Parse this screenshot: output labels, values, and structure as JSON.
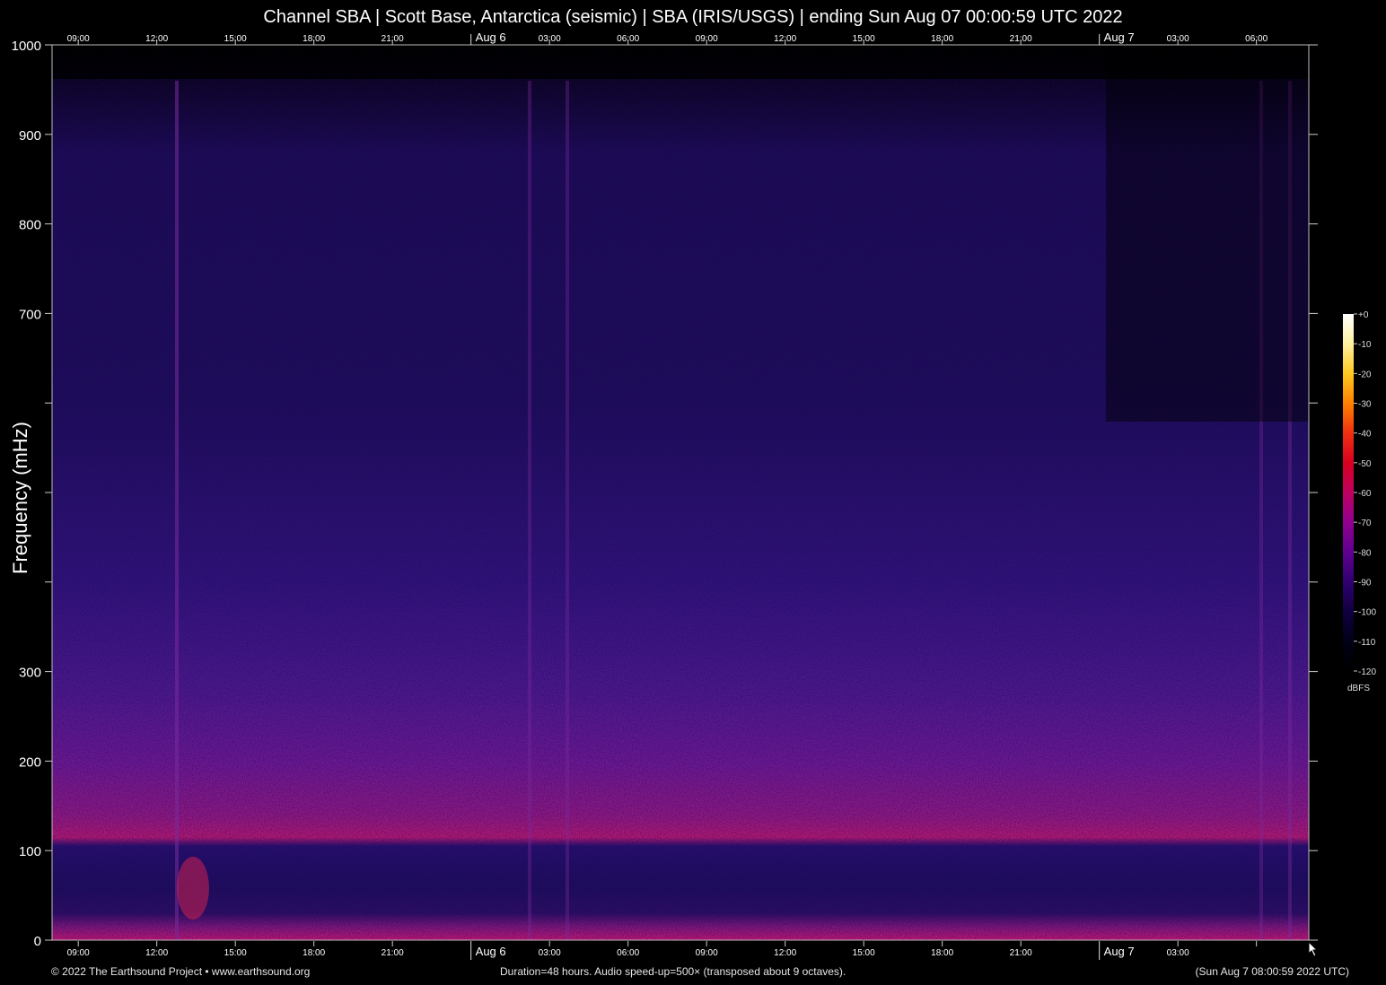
{
  "title": "Channel SBA | Scott Base, Antarctica (seismic) | SBA (IRIS/USGS) | ending Sun Aug 07 00:00:59 UTC 2022",
  "footer": {
    "left": "© 2022 The Earthsound Project • www.earthsound.org",
    "middle": "Duration=48 hours. Audio speed-up=500× (transposed about 9 octaves).",
    "right": "(Sun Aug  7 08:00:59 2022 UTC)"
  },
  "colorbar": {
    "unit": "dBFS",
    "ticks": [
      "+0",
      "-10",
      "-20",
      "-30",
      "-40",
      "-50",
      "-60",
      "-70",
      "-80",
      "-90",
      "-100",
      "-110",
      "-120"
    ],
    "stops": [
      "#ffffff",
      "#fff0a0",
      "#ffc820",
      "#ff8000",
      "#f03010",
      "#d80020",
      "#c00060",
      "#900090",
      "#600090",
      "#300070",
      "#100040",
      "#000018",
      "#000000"
    ]
  },
  "chart_data": {
    "type": "heatmap",
    "title": "Channel SBA | Scott Base, Antarctica (seismic) | SBA (IRIS/USGS) | ending Sun Aug 07 00:00:59 UTC 2022",
    "ylabel": "Frequency (mHz)",
    "ylim": [
      0,
      1000
    ],
    "yticks": [
      {
        "value": 0,
        "label": "0"
      },
      {
        "value": 100,
        "label": "100"
      },
      {
        "value": 200,
        "label": "200"
      },
      {
        "value": 300,
        "label": "300"
      },
      {
        "value": 400,
        "label": ""
      },
      {
        "value": 500,
        "label": ""
      },
      {
        "value": 600,
        "label": ""
      },
      {
        "value": 700,
        "label": "700"
      },
      {
        "value": 800,
        "label": "800"
      },
      {
        "value": 900,
        "label": "900"
      },
      {
        "value": 1000,
        "label": "1000"
      }
    ],
    "x_hours_span": 48,
    "xticks_top": [
      {
        "hour": 9,
        "label": "09:00"
      },
      {
        "hour": 12,
        "label": "12:00"
      },
      {
        "hour": 15,
        "label": "15:00"
      },
      {
        "hour": 18,
        "label": "18:00"
      },
      {
        "hour": 21,
        "label": "21:00"
      },
      {
        "hour": 24,
        "label": "Aug  6",
        "day": true
      },
      {
        "hour": 27,
        "label": "03:00"
      },
      {
        "hour": 30,
        "label": "06:00"
      },
      {
        "hour": 33,
        "label": "09:00"
      },
      {
        "hour": 36,
        "label": "12:00"
      },
      {
        "hour": 39,
        "label": "15:00"
      },
      {
        "hour": 42,
        "label": "18:00"
      },
      {
        "hour": 45,
        "label": "21:00"
      },
      {
        "hour": 48,
        "label": "Aug  7",
        "day": true
      },
      {
        "hour": 51,
        "label": "03:00"
      },
      {
        "hour": 54,
        "label": "06:00"
      }
    ],
    "xticks_bottom": [
      {
        "hour": 9,
        "label": "09:00"
      },
      {
        "hour": 12,
        "label": "12:00"
      },
      {
        "hour": 15,
        "label": "15:00"
      },
      {
        "hour": 18,
        "label": "18:00"
      },
      {
        "hour": 21,
        "label": "21:00"
      },
      {
        "hour": 24,
        "label": "Aug  6",
        "day": true
      },
      {
        "hour": 27,
        "label": "03:00"
      },
      {
        "hour": 30,
        "label": "06:00"
      },
      {
        "hour": 33,
        "label": "09:00"
      },
      {
        "hour": 36,
        "label": "12:00"
      },
      {
        "hour": 39,
        "label": "15:00"
      },
      {
        "hour": 42,
        "label": "18:00"
      },
      {
        "hour": 45,
        "label": "21:00"
      },
      {
        "hour": 48,
        "label": "Aug  7",
        "day": true
      },
      {
        "hour": 51,
        "label": "03:00"
      },
      {
        "hour": 54,
        "label": ""
      }
    ],
    "grid": false
  }
}
